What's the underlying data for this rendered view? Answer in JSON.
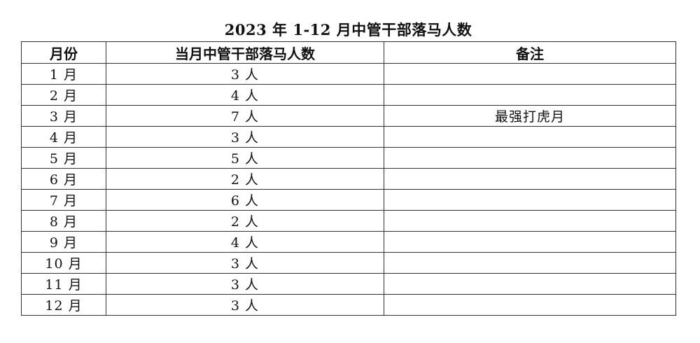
{
  "title": "2023 年 1-12 月中管干部落马人数",
  "table": {
    "headers": [
      "月份",
      "当月中管干部落马人数",
      "备注"
    ],
    "rows": [
      {
        "month": "1 月",
        "count": "3 人",
        "note": ""
      },
      {
        "month": "2 月",
        "count": "4 人",
        "note": ""
      },
      {
        "month": "3 月",
        "count": "7 人",
        "note": "最强打虎月"
      },
      {
        "month": "4 月",
        "count": "3 人",
        "note": ""
      },
      {
        "month": "5 月",
        "count": "5 人",
        "note": ""
      },
      {
        "month": "6 月",
        "count": "2 人",
        "note": ""
      },
      {
        "month": "7 月",
        "count": "6 人",
        "note": ""
      },
      {
        "month": "8 月",
        "count": "2 人",
        "note": ""
      },
      {
        "month": "9 月",
        "count": "4 人",
        "note": ""
      },
      {
        "month": "10 月",
        "count": "3 人",
        "note": ""
      },
      {
        "month": "11 月",
        "count": "3 人",
        "note": ""
      },
      {
        "month": "12 月",
        "count": "3 人",
        "note": ""
      }
    ]
  }
}
